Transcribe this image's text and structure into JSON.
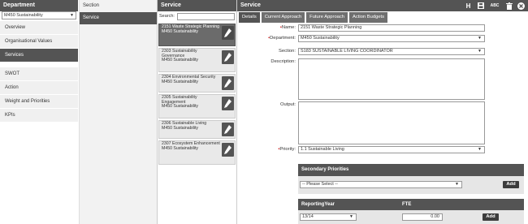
{
  "department": {
    "header": "Department",
    "selected": "M450 Sustainability",
    "menu": [
      "Overview",
      "Organisational Values",
      "Services",
      "SWOT",
      "Action",
      "Weight and Priorities",
      "KPIs"
    ]
  },
  "section": {
    "header": "Section",
    "active_item": "Service"
  },
  "service_list": {
    "header": "Service",
    "search_label": "Search:",
    "search_value": "",
    "items": [
      {
        "title": "2151 Waste Strategic Planning",
        "sub": "M450 Sustainability"
      },
      {
        "title": "2303 Sustainability Governance",
        "sub": "M450 Sustainability"
      },
      {
        "title": "2304 Environmental Security",
        "sub": "M450 Sustainability"
      },
      {
        "title": "2305 Sustainability Engagement",
        "sub": "M450 Sustainability"
      },
      {
        "title": "2306 Sustainable Living",
        "sub": "M450 Sustainability"
      },
      {
        "title": "2307 Ecosystem Enhancement",
        "sub": "M450 Sustainability"
      }
    ]
  },
  "detail": {
    "header": "Service",
    "tabs": [
      "Details",
      "Current Approach",
      "Future Approach",
      "Action Budgets"
    ],
    "toolbar": {
      "h": "H",
      "save": "▪",
      "spell": "ABC",
      "delete": "✕",
      "close": "✕"
    },
    "fields": {
      "name_label": "Name:",
      "name_value": "2151 Waste Strategic Planning",
      "department_label": "Department:",
      "department_value": "M450 Sustainability",
      "section_label": "Section:",
      "section_value": "S183 SUSTAINABLE LIVING COORDINATOR",
      "description_label": "Description:",
      "output_label": "Output:",
      "priority_label": "Priority:",
      "priority_value": "1.1 Sustainable Living"
    },
    "secondary": {
      "header": "Secondary Priorities",
      "select_value": "-- Please Select --",
      "add_label": "Add"
    },
    "reporting": {
      "year_header": "ReportingYear",
      "fte_header": "FTE",
      "year_value": "13/14",
      "fte_value": "0.00",
      "add_label": "Add"
    }
  }
}
